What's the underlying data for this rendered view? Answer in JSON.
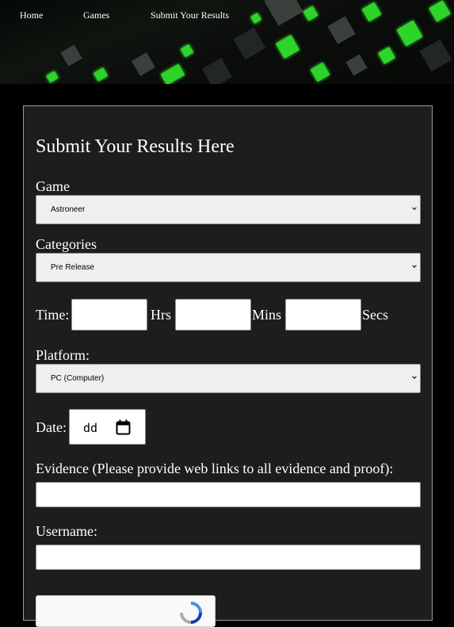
{
  "nav": {
    "home": "Home",
    "games": "Games",
    "submit": "Submit Your Results"
  },
  "form": {
    "heading": "Submit Your Results Here",
    "game": {
      "label": "Game",
      "value": "Astroneer"
    },
    "categories": {
      "label": "Categories",
      "value": "Pre Release"
    },
    "time": {
      "label": "Time:",
      "hrs": "Hrs",
      "mins": "Mins",
      "secs": "Secs",
      "hrs_value": "",
      "mins_value": "",
      "secs_value": ""
    },
    "platform": {
      "label": "Platform:",
      "value": "PC (Computer)"
    },
    "date": {
      "label": "Date:",
      "value": "dd"
    },
    "evidence": {
      "label": "Evidence (Please provide web links to all evidence and proof):",
      "value": ""
    },
    "username": {
      "label": "Username:",
      "value": ""
    }
  },
  "colors": {
    "page_bg": "#000000",
    "panel_bg": "#1d1d1d",
    "banner_accent": "#2fd42a"
  },
  "icons": {
    "select_arrow": "chevron-down-icon",
    "date_picker": "calendar-icon",
    "captcha": "recaptcha-icon"
  }
}
